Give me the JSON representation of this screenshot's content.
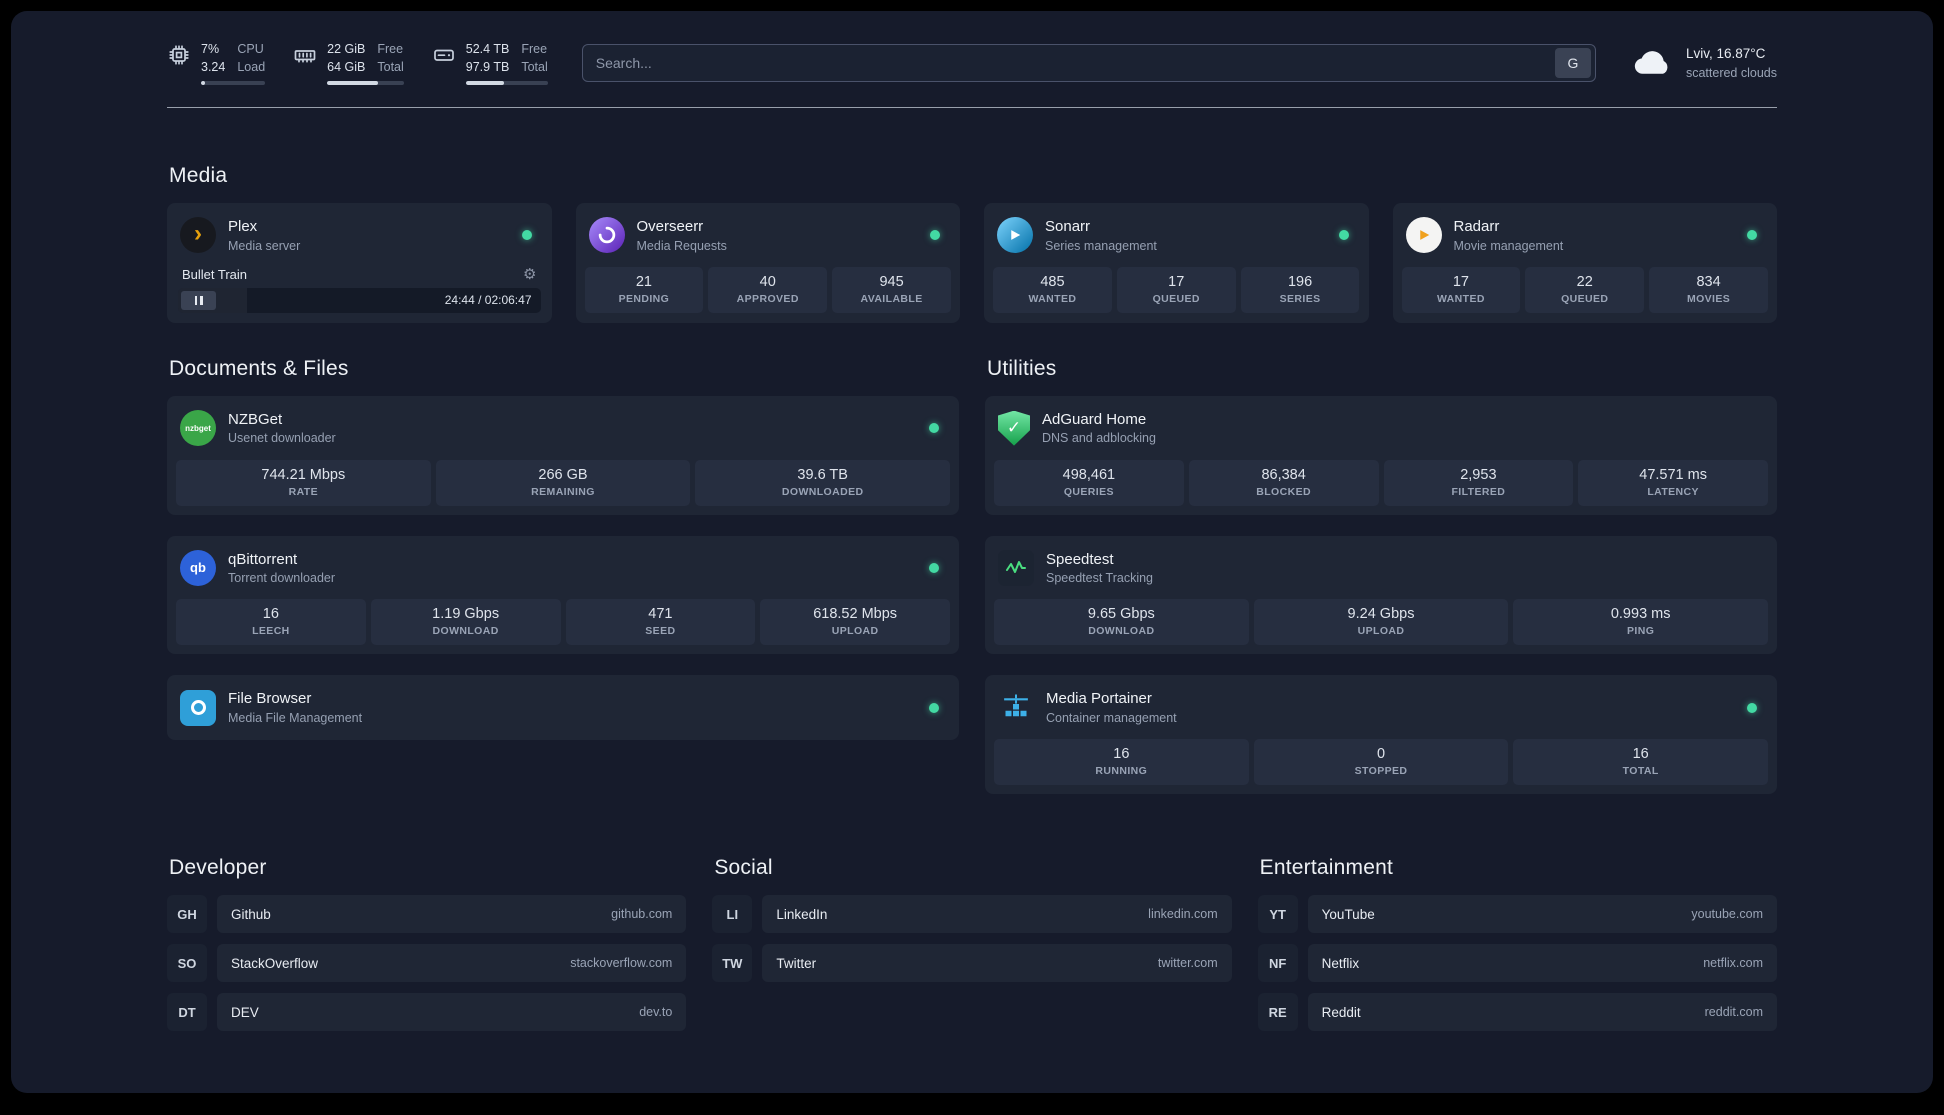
{
  "header": {
    "resources": [
      {
        "icon": "cpu-icon",
        "value_top": "7%",
        "value_bottom": "3.24",
        "label_top": "CPU",
        "label_bottom": "Load",
        "percent": 7
      },
      {
        "icon": "memory-icon",
        "value_top": "22 GiB",
        "value_bottom": "64 GiB",
        "label_top": "Free",
        "label_bottom": "Total",
        "percent": 66
      },
      {
        "icon": "disk-icon",
        "value_top": "52.4 TB",
        "value_bottom": "97.9 TB",
        "label_top": "Free",
        "label_bottom": "Total",
        "percent": 47
      }
    ],
    "search": {
      "placeholder": "Search...",
      "button_label": "G"
    },
    "weather": {
      "icon": "cloud-icon",
      "location": "Lviv, 16.87°C",
      "condition": "scattered clouds"
    }
  },
  "sections": {
    "media": {
      "title": "Media",
      "services": [
        {
          "name": "Plex",
          "description": "Media server",
          "icon": "plex-icon",
          "status": "online",
          "player": {
            "track": "Bullet Train",
            "time": "24:44 / 02:06:47",
            "progress_percent": 19
          }
        },
        {
          "name": "Overseerr",
          "description": "Media Requests",
          "icon": "overseerr-icon",
          "status": "online",
          "stats": [
            {
              "value": "21",
              "label": "PENDING"
            },
            {
              "value": "40",
              "label": "APPROVED"
            },
            {
              "value": "945",
              "label": "AVAILABLE"
            }
          ]
        },
        {
          "name": "Sonarr",
          "description": "Series management",
          "icon": "sonarr-icon",
          "status": "online",
          "stats": [
            {
              "value": "485",
              "label": "WANTED"
            },
            {
              "value": "17",
              "label": "QUEUED"
            },
            {
              "value": "196",
              "label": "SERIES"
            }
          ]
        },
        {
          "name": "Radarr",
          "description": "Movie management",
          "icon": "radarr-icon",
          "status": "online",
          "stats": [
            {
              "value": "17",
              "label": "WANTED"
            },
            {
              "value": "22",
              "label": "QUEUED"
            },
            {
              "value": "834",
              "label": "MOVIES"
            }
          ]
        }
      ]
    },
    "documents": {
      "title": "Documents & Files",
      "services": [
        {
          "name": "NZBGet",
          "description": "Usenet downloader",
          "icon": "nzbget-icon",
          "status": "online",
          "stats": [
            {
              "value": "744.21 Mbps",
              "label": "RATE"
            },
            {
              "value": "266 GB",
              "label": "REMAINING"
            },
            {
              "value": "39.6 TB",
              "label": "DOWNLOADED"
            }
          ]
        },
        {
          "name": "qBittorrent",
          "description": "Torrent downloader",
          "icon": "qbittorrent-icon",
          "status": "online",
          "stats": [
            {
              "value": "16",
              "label": "LEECH"
            },
            {
              "value": "1.19 Gbps",
              "label": "DOWNLOAD"
            },
            {
              "value": "471",
              "label": "SEED"
            },
            {
              "value": "618.52 Mbps",
              "label": "UPLOAD"
            }
          ]
        },
        {
          "name": "File Browser",
          "description": "Media File Management",
          "icon": "filebrowser-icon",
          "status": "online",
          "stats": []
        }
      ]
    },
    "utilities": {
      "title": "Utilities",
      "services": [
        {
          "name": "AdGuard Home",
          "description": "DNS and adblocking",
          "icon": "adguard-icon",
          "stats": [
            {
              "value": "498,461",
              "label": "QUERIES"
            },
            {
              "value": "86,384",
              "label": "BLOCKED"
            },
            {
              "value": "2,953",
              "label": "FILTERED"
            },
            {
              "value": "47.571 ms",
              "label": "LATENCY"
            }
          ]
        },
        {
          "name": "Speedtest",
          "description": "Speedtest Tracking",
          "icon": "speedtest-icon",
          "stats": [
            {
              "value": "9.65 Gbps",
              "label": "DOWNLOAD"
            },
            {
              "value": "9.24 Gbps",
              "label": "UPLOAD"
            },
            {
              "value": "0.993 ms",
              "label": "PING"
            }
          ]
        },
        {
          "name": "Media Portainer",
          "description": "Container management",
          "icon": "portainer-icon",
          "status": "online",
          "stats": [
            {
              "value": "16",
              "label": "RUNNING"
            },
            {
              "value": "0",
              "label": "STOPPED"
            },
            {
              "value": "16",
              "label": "TOTAL"
            }
          ]
        }
      ]
    }
  },
  "bookmarks": {
    "groups": [
      {
        "title": "Developer",
        "items": [
          {
            "abbr": "GH",
            "name": "Github",
            "url": "github.com"
          },
          {
            "abbr": "SO",
            "name": "StackOverflow",
            "url": "stackoverflow.com"
          },
          {
            "abbr": "DT",
            "name": "DEV",
            "url": "dev.to"
          }
        ]
      },
      {
        "title": "Social",
        "items": [
          {
            "abbr": "LI",
            "name": "LinkedIn",
            "url": "linkedin.com"
          },
          {
            "abbr": "TW",
            "name": "Twitter",
            "url": "twitter.com"
          }
        ]
      },
      {
        "title": "Entertainment",
        "items": [
          {
            "abbr": "YT",
            "name": "YouTube",
            "url": "youtube.com"
          },
          {
            "abbr": "NF",
            "name": "Netflix",
            "url": "netflix.com"
          },
          {
            "abbr": "RE",
            "name": "Reddit",
            "url": "reddit.com"
          }
        ]
      }
    ]
  },
  "colors": {
    "status_online": "#43d9a3",
    "plex_accent": "#e5a00d",
    "background": "#161b2b"
  }
}
